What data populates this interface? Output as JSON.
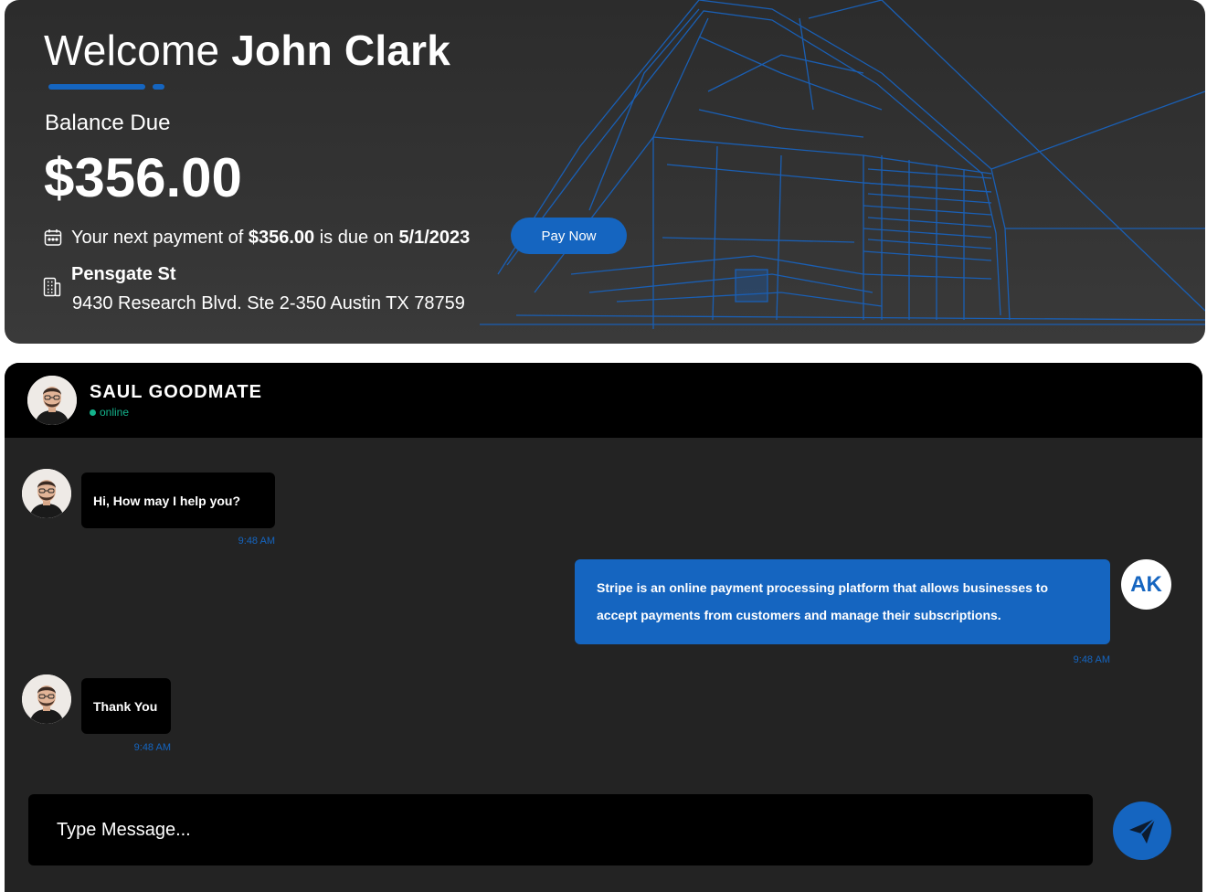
{
  "banner": {
    "welcome_prefix": "Welcome",
    "user_name": "John Clark",
    "balance_label": "Balance Due",
    "balance_amount": "$356.00",
    "due_text_1": "Your next payment of",
    "due_amount": "$356.00",
    "due_text_2": "is due on",
    "due_date": "5/1/2023",
    "pay_button": "Pay Now",
    "property_name": "Pensgate St",
    "property_address": "9430 Research Blvd. Ste 2-350 Austin TX 78759"
  },
  "chat": {
    "contact_name": "SAUL GOODMATE",
    "contact_status": "online",
    "messages": [
      {
        "from": "agent",
        "text": "Hi, How may I help you?",
        "time": "9:48 AM"
      },
      {
        "from": "user",
        "text": "Stripe is an online payment processing platform that allows businesses to accept payments from customers and manage their subscriptions.",
        "time": "9:48 AM"
      },
      {
        "from": "agent",
        "text": "Thank You",
        "time": "9:48 AM"
      }
    ],
    "user_initials": "AK",
    "input_placeholder": "Type Message..."
  },
  "colors": {
    "accent": "#1565c0",
    "online": "#14b38c",
    "banner_bg": "#333333",
    "chat_bg": "#232323",
    "header_bg": "#000000"
  },
  "icons": {
    "calendar": "calendar-icon",
    "building": "building-icon",
    "send": "paper-plane-icon"
  }
}
